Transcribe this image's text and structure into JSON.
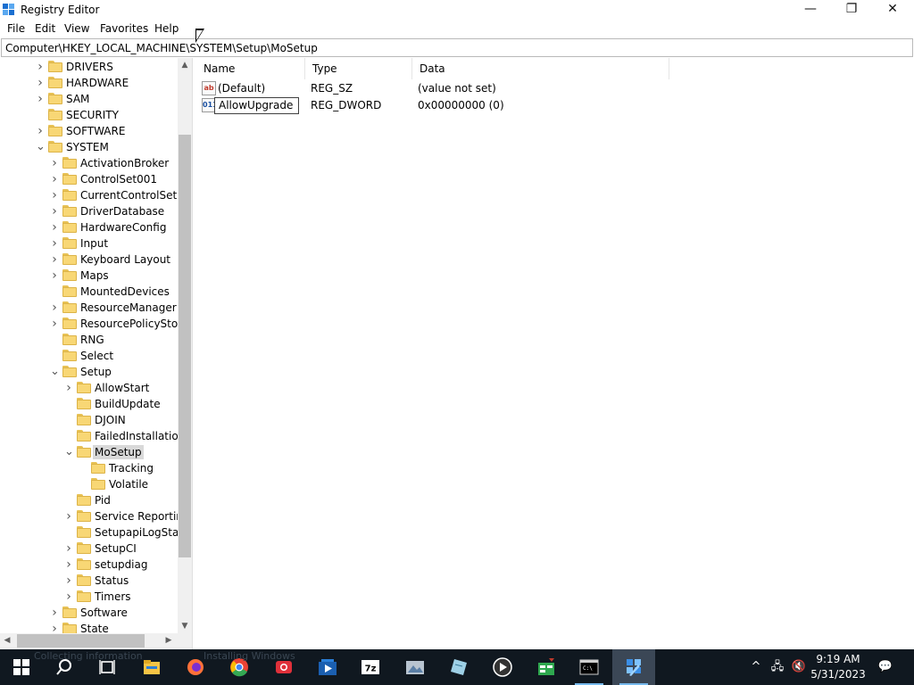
{
  "window": {
    "title": "Registry Editor",
    "controls": {
      "minimize": "—",
      "restore": "❐",
      "close": "✕"
    }
  },
  "menu": [
    "File",
    "Edit",
    "View",
    "Favorites",
    "Help"
  ],
  "address": "Computer\\HKEY_LOCAL_MACHINE\\SYSTEM\\Setup\\MoSetup",
  "tree": [
    {
      "label": "DRIVERS",
      "level": 0,
      "expander": "collapsed"
    },
    {
      "label": "HARDWARE",
      "level": 0,
      "expander": "collapsed"
    },
    {
      "label": "SAM",
      "level": 0,
      "expander": "collapsed"
    },
    {
      "label": "SECURITY",
      "level": 0,
      "expander": "none"
    },
    {
      "label": "SOFTWARE",
      "level": 0,
      "expander": "collapsed"
    },
    {
      "label": "SYSTEM",
      "level": 0,
      "expander": "expanded"
    },
    {
      "label": "ActivationBroker",
      "level": 1,
      "expander": "collapsed"
    },
    {
      "label": "ControlSet001",
      "level": 1,
      "expander": "collapsed"
    },
    {
      "label": "CurrentControlSet",
      "level": 1,
      "expander": "collapsed"
    },
    {
      "label": "DriverDatabase",
      "level": 1,
      "expander": "collapsed"
    },
    {
      "label": "HardwareConfig",
      "level": 1,
      "expander": "collapsed"
    },
    {
      "label": "Input",
      "level": 1,
      "expander": "collapsed"
    },
    {
      "label": "Keyboard Layout",
      "level": 1,
      "expander": "collapsed"
    },
    {
      "label": "Maps",
      "level": 1,
      "expander": "collapsed"
    },
    {
      "label": "MountedDevices",
      "level": 1,
      "expander": "none"
    },
    {
      "label": "ResourceManager",
      "level": 1,
      "expander": "collapsed"
    },
    {
      "label": "ResourcePolicyStore",
      "level": 1,
      "expander": "collapsed"
    },
    {
      "label": "RNG",
      "level": 1,
      "expander": "none"
    },
    {
      "label": "Select",
      "level": 1,
      "expander": "none"
    },
    {
      "label": "Setup",
      "level": 1,
      "expander": "expanded"
    },
    {
      "label": "AllowStart",
      "level": 2,
      "expander": "collapsed"
    },
    {
      "label": "BuildUpdate",
      "level": 2,
      "expander": "none"
    },
    {
      "label": "DJOIN",
      "level": 2,
      "expander": "none"
    },
    {
      "label": "FailedInstallations",
      "level": 2,
      "expander": "none"
    },
    {
      "label": "MoSetup",
      "level": 2,
      "expander": "expanded",
      "selected": true
    },
    {
      "label": "Tracking",
      "level": 3,
      "expander": "none"
    },
    {
      "label": "Volatile",
      "level": 3,
      "expander": "none"
    },
    {
      "label": "Pid",
      "level": 2,
      "expander": "none"
    },
    {
      "label": "Service Reporting",
      "level": 2,
      "expander": "collapsed"
    },
    {
      "label": "SetupapiLogStatus",
      "level": 2,
      "expander": "none"
    },
    {
      "label": "SetupCI",
      "level": 2,
      "expander": "collapsed"
    },
    {
      "label": "setupdiag",
      "level": 2,
      "expander": "collapsed"
    },
    {
      "label": "Status",
      "level": 2,
      "expander": "collapsed"
    },
    {
      "label": "Timers",
      "level": 2,
      "expander": "collapsed"
    },
    {
      "label": "Software",
      "level": 1,
      "expander": "collapsed"
    },
    {
      "label": "State",
      "level": 1,
      "expander": "collapsed"
    }
  ],
  "columns": {
    "name": "Name",
    "type": "Type",
    "data": "Data"
  },
  "values": [
    {
      "name": "(Default)",
      "type": "REG_SZ",
      "data": "(value not set)",
      "icon": "string-value-icon",
      "icon_text": "ab",
      "editing": false
    },
    {
      "name": "AllowUpgrade",
      "type": "REG_DWORD",
      "data": "0x00000000 (0)",
      "icon": "binary-value-icon",
      "icon_text": "011",
      "editing": true
    }
  ],
  "taskbar": {
    "ghost_text": [
      "Collecting information",
      "Installing Windows"
    ],
    "apps": [
      {
        "name": "start-button",
        "color": "#ffffff",
        "active": false,
        "open": false
      },
      {
        "name": "search-icon",
        "color": "#ffffff",
        "active": false,
        "open": false
      },
      {
        "name": "task-view-icon",
        "color": "#ffffff",
        "active": false,
        "open": false
      },
      {
        "name": "file-explorer-icon",
        "color": "#f6c445",
        "active": false,
        "open": false
      },
      {
        "name": "firefox-icon",
        "color": "#ff7139",
        "active": false,
        "open": false
      },
      {
        "name": "chrome-icon",
        "color": "#34a853",
        "active": false,
        "open": false
      },
      {
        "name": "screen-recorder-icon",
        "color": "#e0303a",
        "active": false,
        "open": false
      },
      {
        "name": "media-player-icon",
        "color": "#2a7fd8",
        "active": false,
        "open": false
      },
      {
        "name": "7zip-icon",
        "color": "#ffffff",
        "active": false,
        "open": false
      },
      {
        "name": "image-viewer-icon",
        "color": "#b8c4d0",
        "active": false,
        "open": false
      },
      {
        "name": "notes-icon",
        "color": "#9ed0e6",
        "active": false,
        "open": false
      },
      {
        "name": "audio-player-icon",
        "color": "#ffffff",
        "active": false,
        "open": false
      },
      {
        "name": "spreadsheet-icon",
        "color": "#2fa84f",
        "active": false,
        "open": false
      },
      {
        "name": "terminal-icon",
        "color": "#d0d0d0",
        "active": false,
        "open": true
      },
      {
        "name": "registry-editor-icon",
        "color": "#3a8ee6",
        "active": true,
        "open": true
      }
    ],
    "tray": {
      "chevron": "^",
      "network": "🖧",
      "volume": "🔇",
      "notification": "💬"
    },
    "clock": {
      "time": "9:19 AM",
      "date": "5/31/2023"
    }
  }
}
